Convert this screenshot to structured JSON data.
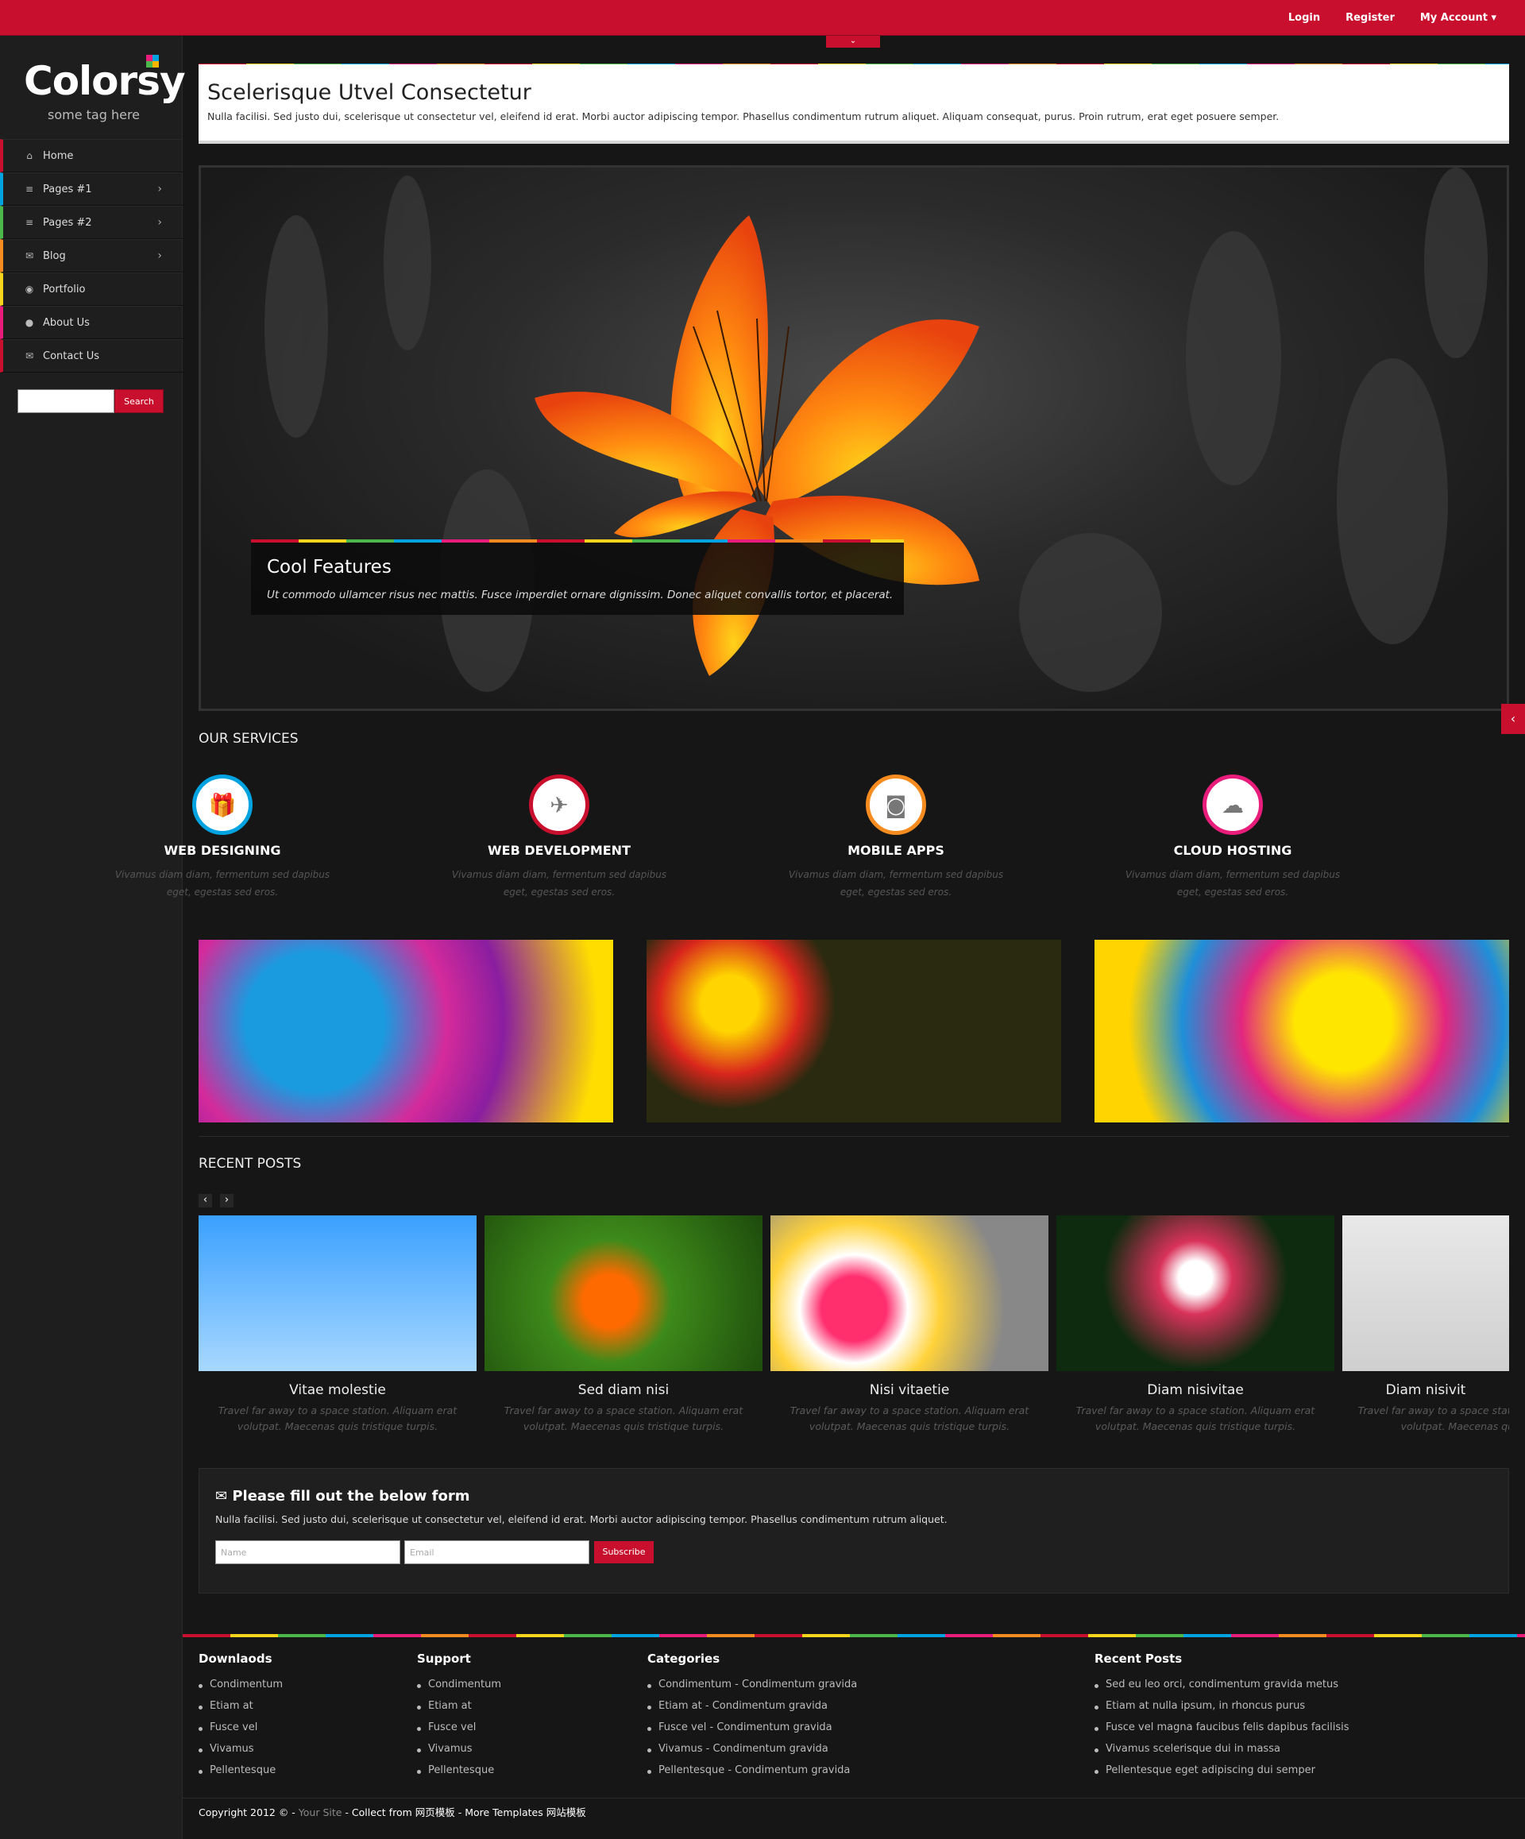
{
  "topnav": {
    "login": "Login",
    "register": "Register",
    "account": "My Account ▾"
  },
  "brand": {
    "name": "Colorsy",
    "tagline": "some tag here"
  },
  "menu": [
    {
      "label": "Home",
      "icon": "home-icon",
      "color": "#c8102e",
      "glyph": "⌂",
      "sub": false
    },
    {
      "label": "Pages #1",
      "icon": "list-icon",
      "color": "#00a3e0",
      "glyph": "≡",
      "sub": true
    },
    {
      "label": "Pages #2",
      "icon": "list-icon",
      "color": "#4cb84c",
      "glyph": "≡",
      "sub": true
    },
    {
      "label": "Blog",
      "icon": "comments-icon",
      "color": "#f68b1f",
      "glyph": "✉",
      "sub": true
    },
    {
      "label": "Portfolio",
      "icon": "camera-icon",
      "color": "#f7d51d",
      "glyph": "◉",
      "sub": false
    },
    {
      "label": "About Us",
      "icon": "user-icon",
      "color": "#e81d7b",
      "glyph": "●",
      "sub": false
    },
    {
      "label": "Contact Us",
      "icon": "envelope-icon",
      "color": "#c8102e",
      "glyph": "✉",
      "sub": false
    }
  ],
  "search": {
    "button": "Search"
  },
  "intro": {
    "title": "Scelerisque Utvel Consectetur",
    "text": "Nulla facilisi. Sed justo dui, scelerisque ut consectetur vel, eleifend id erat. Morbi auctor adipiscing tempor. Phasellus condimentum rutrum aliquet. Aliquam consequat, purus. Proin rutrum, erat eget posuere semper."
  },
  "slider": {
    "caption_title": "Cool Features",
    "caption_text": "Ut commodo ullamcer risus nec mattis. Fusce imperdiet ornare dignissim. Donec aliquet convallis tortor, et placerat."
  },
  "services": {
    "title": "OUR SERVICES",
    "items": [
      {
        "title": "WEB DESIGNING",
        "text": "Vivamus diam diam, fermentum sed dapibus eget, egestas sed eros.",
        "icon": "gift-icon",
        "glyph": "🎁",
        "color": "#00a3e0"
      },
      {
        "title": "WEB DEVELOPMENT",
        "text": "Vivamus diam diam, fermentum sed dapibus eget, egestas sed eros.",
        "icon": "plane-icon",
        "glyph": "✈",
        "color": "#c8102e"
      },
      {
        "title": "MOBILE APPS",
        "text": "Vivamus diam diam, fermentum sed dapibus eget, egestas sed eros.",
        "icon": "camera-icon",
        "glyph": "◙",
        "color": "#f68b1f"
      },
      {
        "title": "CLOUD HOSTING",
        "text": "Vivamus diam diam, fermentum sed dapibus eget, egestas sed eros.",
        "icon": "cloud-icon",
        "glyph": "☁",
        "color": "#e81d7b"
      }
    ]
  },
  "recent": {
    "title": "RECENT POSTS",
    "posts": [
      {
        "title": "Vitae molestie",
        "text": "Travel far away to a space station. Aliquam erat volutpat. Maecenas quis tristique turpis."
      },
      {
        "title": "Sed diam nisi",
        "text": "Travel far away to a space station. Aliquam erat volutpat. Maecenas quis tristique turpis."
      },
      {
        "title": "Nisi vitaetie",
        "text": "Travel far away to a space station. Aliquam erat volutpat. Maecenas quis tristique turpis."
      },
      {
        "title": "Diam nisivitae",
        "text": "Travel far away to a space station. Aliquam erat volutpat. Maecenas quis tristique turpis."
      },
      {
        "title": "Diam nisivit",
        "text": "Travel far away to a space station. Aliquam erat volutpat. Maecenas quis tristiq"
      }
    ]
  },
  "form": {
    "title": "Please fill out the below form",
    "text": "Nulla facilisi. Sed justo dui, scelerisque ut consectetur vel, eleifend id erat. Morbi auctor adipiscing tempor. Phasellus condimentum rutrum aliquet.",
    "name_placeholder": "Name",
    "email_placeholder": "Email",
    "button": "Subscribe"
  },
  "footer": {
    "cols": [
      {
        "title": "Downlaods",
        "items": [
          "Condimentum",
          "Etiam at",
          "Fusce vel",
          "Vivamus",
          "Pellentesque"
        ]
      },
      {
        "title": "Support",
        "items": [
          "Condimentum",
          "Etiam at",
          "Fusce vel",
          "Vivamus",
          "Pellentesque"
        ]
      },
      {
        "title": "Categories",
        "items": [
          "Condimentum - Condimentum gravida",
          "Etiam at - Condimentum gravida",
          "Fusce vel - Condimentum gravida",
          "Vivamus - Condimentum gravida",
          "Pellentesque - Condimentum gravida"
        ]
      },
      {
        "title": "Recent Posts",
        "items": [
          "Sed eu leo orci, condimentum gravida metus",
          "Etiam at nulla ipsum, in rhoncus purus",
          "Fusce vel magna faucibus felis dapibus facilisis",
          "Vivamus scelerisque dui in massa",
          "Pellentesque eget adipiscing dui semper"
        ]
      }
    ],
    "copy_prefix": "Copyright 2012 © - ",
    "copy_site": "Your Site",
    "copy_rest": " - Collect from 网页模板 - More Templates 网站模板"
  },
  "colors": {
    "accent": "#c8102e",
    "bg": "#161616"
  }
}
